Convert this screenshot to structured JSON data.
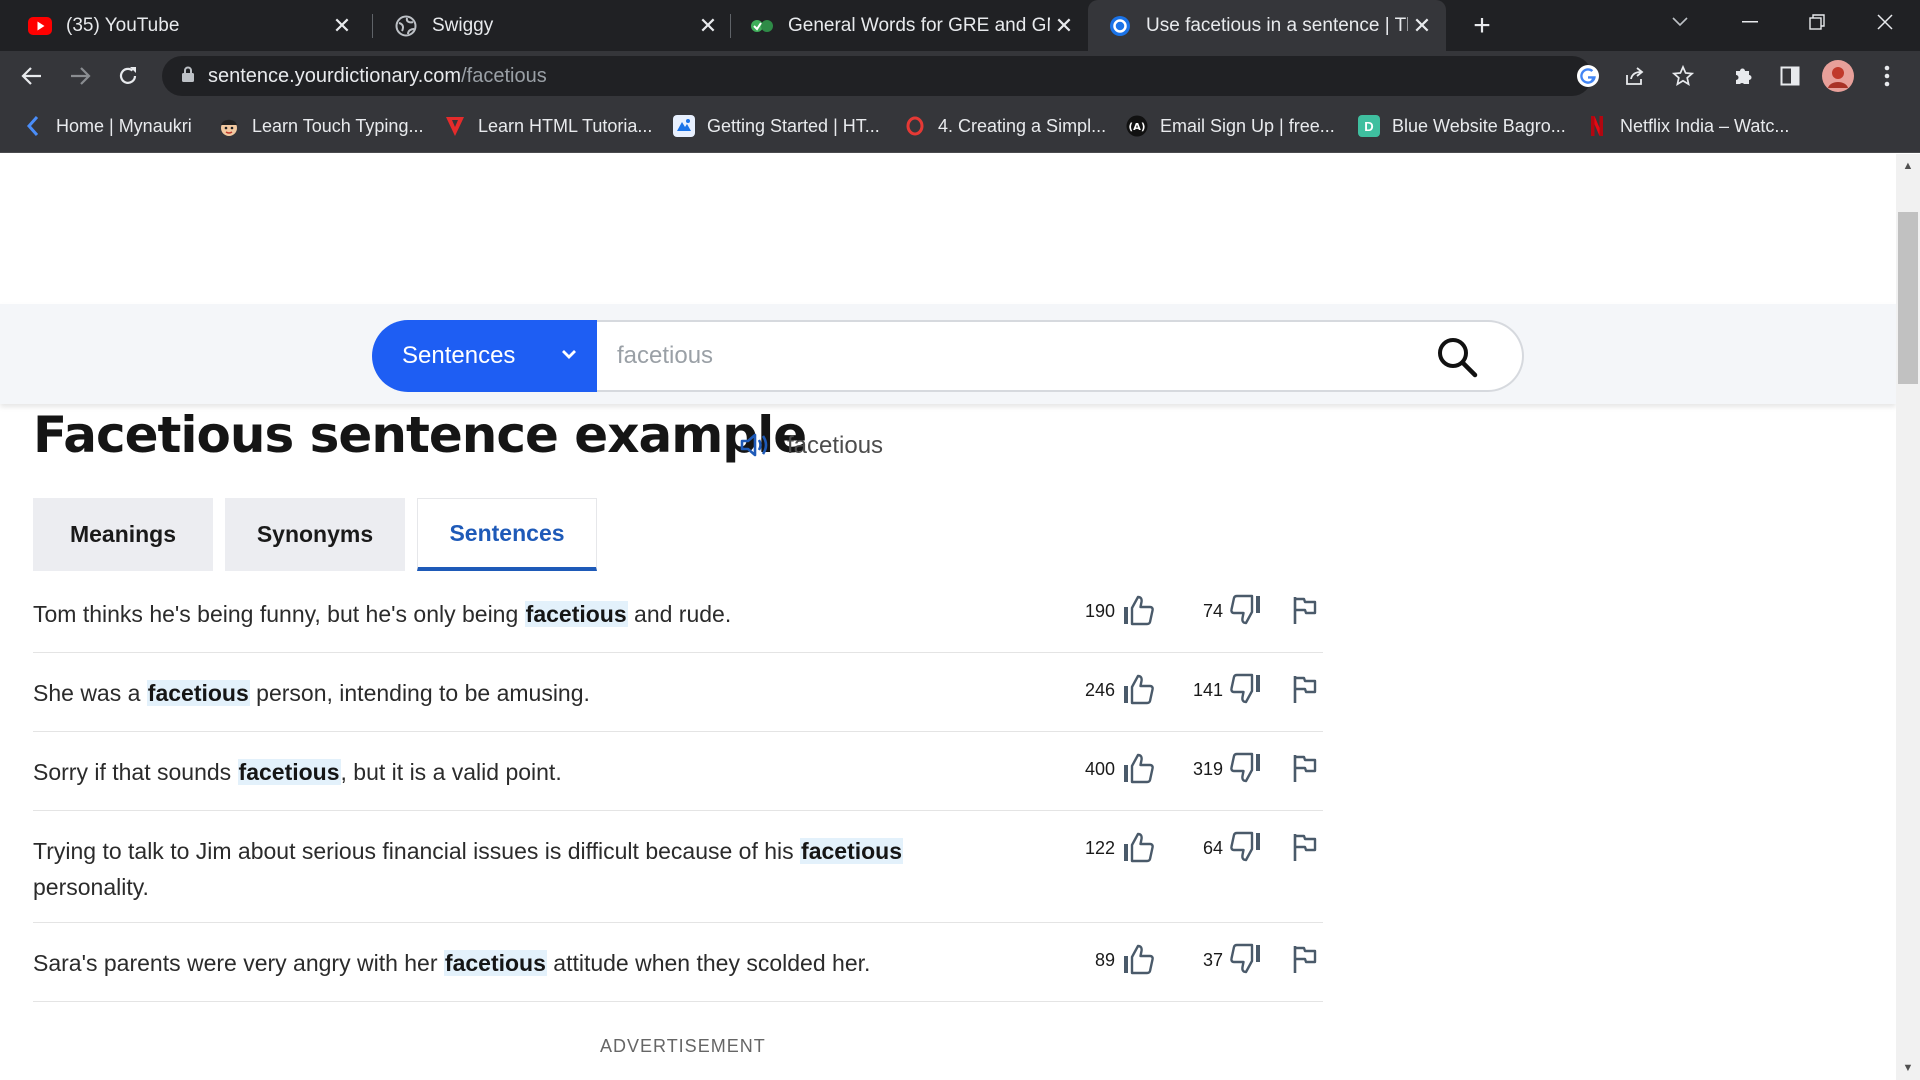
{
  "browser": {
    "tabs": [
      {
        "title": "(35) YouTube",
        "icon": "youtube-icon",
        "active": false
      },
      {
        "title": "Swiggy",
        "icon": "globe-icon",
        "active": false
      },
      {
        "title": "General Words for GRE and GMA",
        "icon": "wordsmith-icon",
        "active": false
      },
      {
        "title": "Use facetious in a sentence | The",
        "icon": "yourdictionary-icon",
        "active": true
      }
    ],
    "url_host": "sentence.yourdictionary.com",
    "url_path": "/facetious",
    "bookmarks": [
      {
        "label": "Home | Mynaukri",
        "icon": "mynaukri-icon"
      },
      {
        "label": "Learn Touch Typing...",
        "icon": "typing-icon"
      },
      {
        "label": "Learn HTML Tutoria...",
        "icon": "html-tutorial-icon"
      },
      {
        "label": "Getting Started | HT...",
        "icon": "getting-started-icon"
      },
      {
        "label": "4. Creating a Simpl...",
        "icon": "opera-icon"
      },
      {
        "label": "Email Sign Up | free...",
        "icon": "email-signup-icon"
      },
      {
        "label": "Blue Website Bagro...",
        "icon": "blue-website-icon"
      },
      {
        "label": "Netflix India – Watc...",
        "icon": "netflix-icon"
      }
    ]
  },
  "search": {
    "mode": "Sentences",
    "placeholder": "facetious"
  },
  "page": {
    "title": "Facetious sentence example",
    "pronunciation": "facetious",
    "tabs": [
      "Meanings",
      "Synonyms",
      "Sentences"
    ],
    "active_tab": "Sentences",
    "advertisement_label": "ADVERTISEMENT"
  },
  "sentences": [
    {
      "before": "Tom thinks he's being funny, but he's only being ",
      "word": "facetious",
      "after": " and rude.",
      "upvotes": "190",
      "downvotes": "74"
    },
    {
      "before": "She was a ",
      "word": "facetious",
      "after": " person, intending to be amusing.",
      "upvotes": "246",
      "downvotes": "141"
    },
    {
      "before": "Sorry if that sounds ",
      "word": "facetious",
      "after": ", but it is a valid point.",
      "upvotes": "400",
      "downvotes": "319"
    },
    {
      "before": "Trying to talk to Jim about serious financial issues is difficult because of his ",
      "word": "facetious",
      "after": " personality.",
      "upvotes": "122",
      "downvotes": "64"
    },
    {
      "before": "Sara's parents were very angry with her ",
      "word": "facetious",
      "after": " attitude when they scolded her.",
      "upvotes": "89",
      "downvotes": "37"
    }
  ],
  "colors": {
    "accent_blue": "#1e5ef3",
    "tab_active_blue": "#1e5ab8",
    "highlight": "#e3f1fb"
  }
}
